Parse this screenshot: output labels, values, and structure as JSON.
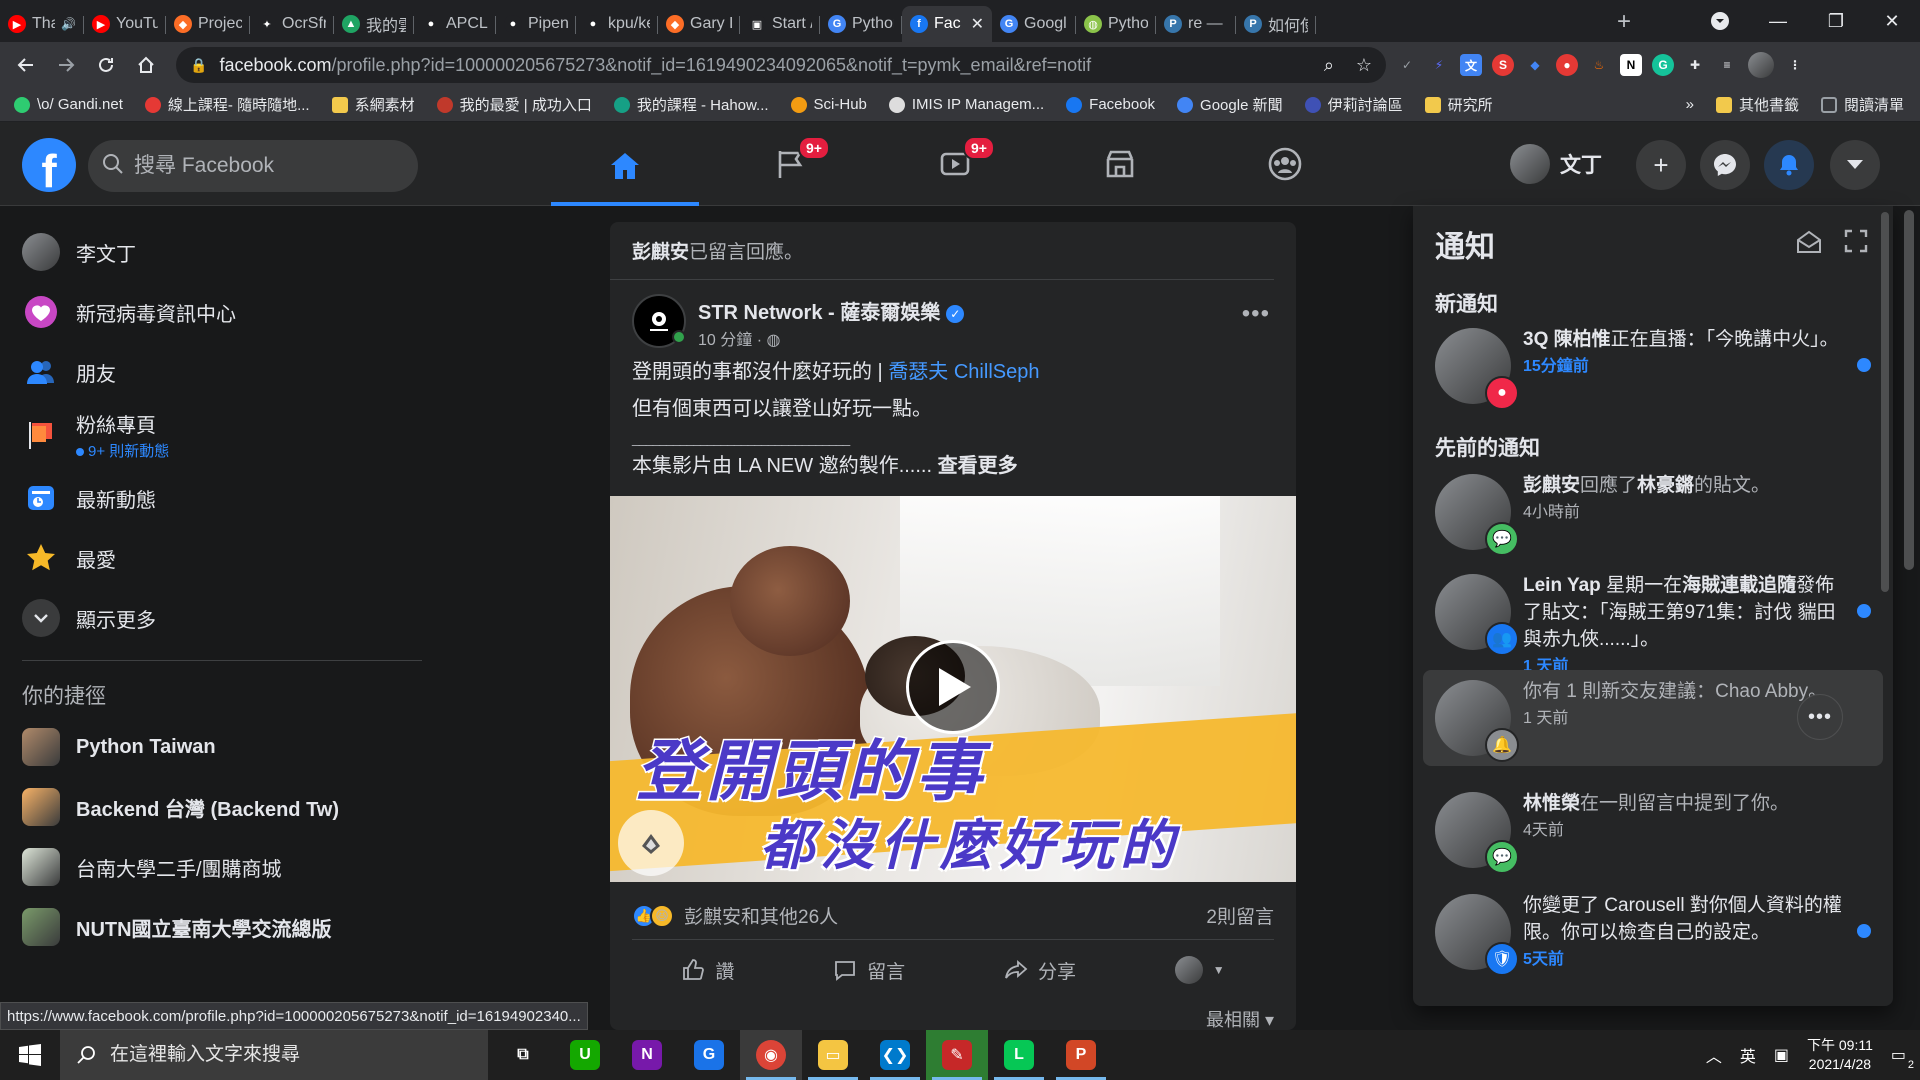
{
  "browser": {
    "tabs": [
      {
        "title": "Tha",
        "color": "#ff0000",
        "glyph": "▶",
        "audio": true
      },
      {
        "title": "YouTul",
        "color": "#ff0000",
        "glyph": "▶"
      },
      {
        "title": "Project",
        "color": "#fc6d26",
        "glyph": "◆"
      },
      {
        "title": "OcrSfr",
        "color": "#202124",
        "glyph": "✦"
      },
      {
        "title": "我的雲",
        "color": "#1fa463",
        "glyph": "▲"
      },
      {
        "title": "APCLa",
        "color": "#202124",
        "glyph": "●"
      },
      {
        "title": "Pipenv",
        "color": "#202124",
        "glyph": "●"
      },
      {
        "title": "kpu/ke",
        "color": "#202124",
        "glyph": "●"
      },
      {
        "title": "Gary L",
        "color": "#fc6d26",
        "glyph": "◆"
      },
      {
        "title": "Start /",
        "color": "#202124",
        "glyph": "▣"
      },
      {
        "title": "Python",
        "color": "#4285f4",
        "glyph": "G"
      },
      {
        "title": "Fac",
        "color": "#1877f2",
        "glyph": "f",
        "active": true
      },
      {
        "title": "Googl",
        "color": "#4285f4",
        "glyph": "G"
      },
      {
        "title": "Python",
        "color": "#8bc34a",
        "glyph": "◍"
      },
      {
        "title": "re — R",
        "color": "#3776ab",
        "glyph": "P"
      },
      {
        "title": "如何使",
        "color": "#3776ab",
        "glyph": "P"
      }
    ],
    "address": {
      "host": "facebook.com",
      "path": "/profile.php?id=100000205675273&notif_id=1619490234092065&notif_t=pymk_email&ref=notif"
    },
    "bookmarks": [
      {
        "label": "\\o/ Gandi.net",
        "color": "#2ecc71"
      },
      {
        "label": "線上課程- 隨時隨地...",
        "color": "#e53935"
      },
      {
        "label": "系網素材",
        "color": "folder"
      },
      {
        "label": "我的最愛 | 成功入口",
        "color": "#c0392b"
      },
      {
        "label": "我的課程 - Hahow...",
        "color": "#16a085"
      },
      {
        "label": "Sci-Hub",
        "color": "#f39c12"
      },
      {
        "label": "IMIS IP Managem...",
        "color": "#dddddd"
      },
      {
        "label": "Facebook",
        "color": "#1877f2"
      },
      {
        "label": "Google 新聞",
        "color": "#4285f4"
      },
      {
        "label": "伊莉討論區",
        "color": "#3f51b5"
      },
      {
        "label": "研究所",
        "color": "folder"
      }
    ],
    "bookmarks_overflow": "»",
    "bookmarks_right": [
      {
        "label": "其他書籤",
        "color": "folder"
      },
      {
        "label": "閱讀清單",
        "color": "#9aa0a6"
      }
    ],
    "status_url": "https://www.facebook.com/profile.php?id=100000205675273&notif_id=16194902340..."
  },
  "fb": {
    "logo": "f",
    "search_placeholder": "搜尋 Facebook",
    "badges": {
      "pages": "9+",
      "watch": "9+"
    },
    "profile_name": "文丁",
    "left_nav": [
      {
        "label": "李文丁",
        "icon": "profile-avatar"
      },
      {
        "label": "新冠病毒資訊中心",
        "icon": "covid-heart-icon"
      },
      {
        "label": "朋友",
        "icon": "friends-icon"
      },
      {
        "label": "粉絲專頁",
        "icon": "flag-icon",
        "sub": "9+ 則新動態"
      },
      {
        "label": "最新動態",
        "icon": "news-feed-icon"
      },
      {
        "label": "最愛",
        "icon": "star-icon"
      },
      {
        "label": "顯示更多",
        "icon": "chevron-down-icon"
      }
    ],
    "shortcuts_title": "你的捷徑",
    "shortcuts": [
      {
        "label": "Python Taiwan",
        "color": "#b08a6a"
      },
      {
        "label": "Backend 台灣 (Backend Tw)",
        "color": "#f7b267"
      },
      {
        "label": "台南大學二手/團購商城",
        "color": "#dde5d8"
      },
      {
        "label": "NUTN國立臺南大學交流總版",
        "color": "#7a9a6a"
      }
    ],
    "post": {
      "activity_actor": "彭麒安",
      "activity_text": "已留言回應。",
      "page_name": "STR Network - 薩泰爾娛樂",
      "time": "10 分鐘 · ",
      "line1": "登開頭的事都沒什麼好玩的 | ",
      "mention": "喬瑟夫 ChillSeph",
      "line2": "但有個東西可以讓登山好玩一點。",
      "line3": "________________________________",
      "line4": "本集影片由 LA NEW 邀約製作......",
      "see_more": "查看更多",
      "video_title1": "登開頭的事",
      "video_title2": "都沒什麼好玩的",
      "reactions_text": "彭麒安和其他26人",
      "comments_count": "2則留言",
      "action_like": "讚",
      "action_comment": "留言",
      "action_share": "分享",
      "sort": "最相關 ▾"
    },
    "notifications": {
      "title": "通知",
      "new_heading": "新通知",
      "earlier_heading": "先前的通知",
      "items": [
        {
          "bold": "3Q 陳柏惟",
          "text": "正在直播：「今晚講中火」。",
          "time": "15分鐘前",
          "unread": true,
          "badge": "live",
          "badge_color": "#f02849"
        },
        {
          "bold": "彭麒安",
          "text": "回應了",
          "bold2": "林豪鏘",
          "text2": "的貼文。",
          "time": "4小時前",
          "unread": false,
          "badge": "comment",
          "badge_color": "#45bd62"
        },
        {
          "bold": "Lein Yap",
          "text": " 星期一在",
          "bold2": "海賊連載追隨",
          "text2": "發佈了貼文：「海賊王第971集：討伐 貒田與赤九俠......」。",
          "time": "1 天前",
          "unread": true,
          "badge": "group",
          "badge_color": "#1877f2"
        },
        {
          "bold": "",
          "text": "你有 1 則新交友建議：Chao Abby。",
          "time": "1 天前",
          "unread": false,
          "badge": "bell",
          "badge_color": "#8a8d91",
          "highlight": true
        },
        {
          "bold": "林惟榮",
          "text": "在一則留言中提到了你。",
          "time": "4天前",
          "unread": false,
          "badge": "comment",
          "badge_color": "#45bd62"
        },
        {
          "bold": "",
          "text": "你變更了 Carousell 對你個人資料的權限。你可以檢查自己的設定。",
          "time": "5天前",
          "unread": true,
          "badge": "shield",
          "badge_color": "#1877f2"
        }
      ]
    }
  },
  "taskbar": {
    "search_placeholder": "在這裡輸入文字來搜尋",
    "apps": [
      {
        "name": "task-view",
        "color": "#1f1f1f",
        "glyph": "⧉"
      },
      {
        "name": "upwork",
        "color": "#14a800",
        "glyph": "U"
      },
      {
        "name": "onenote",
        "color": "#7719aa",
        "glyph": "N"
      },
      {
        "name": "edge-app",
        "color": "#1a73e8",
        "glyph": "G"
      },
      {
        "name": "chrome",
        "color": "#db4437",
        "glyph": "◉",
        "active": true
      },
      {
        "name": "file-explorer",
        "color": "#f4c542",
        "glyph": "▭"
      },
      {
        "name": "vscode",
        "color": "#007acc",
        "glyph": "❮❯"
      },
      {
        "name": "draw-app",
        "color": "#c62828",
        "glyph": "✎",
        "highlight": true
      },
      {
        "name": "line",
        "color": "#06c755",
        "glyph": "L"
      },
      {
        "name": "powerpoint",
        "color": "#d24726",
        "glyph": "P"
      }
    ],
    "ime": "英",
    "time": "下午 09:11",
    "date": "2021/4/28",
    "notif_count": "2"
  }
}
